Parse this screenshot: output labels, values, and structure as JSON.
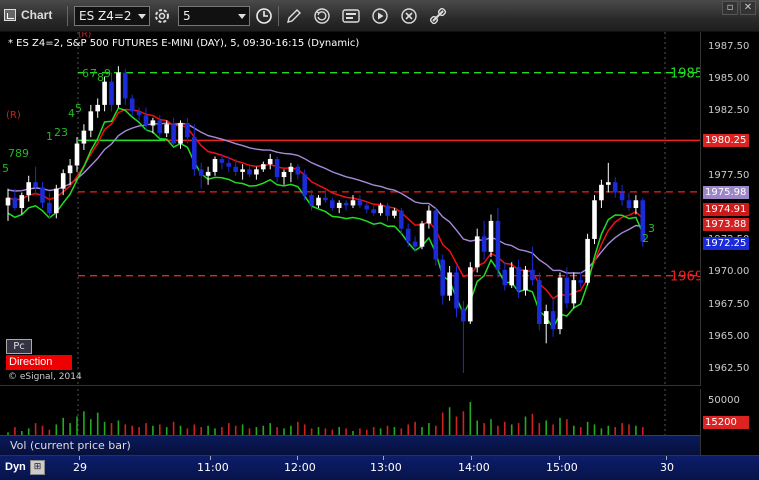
{
  "toolbar": {
    "title": "Chart",
    "symbol_value": "ES Z4=2",
    "interval_value": "5",
    "icons": [
      "chart-window-icon",
      "settings-cog-icon",
      "clock-icon",
      "pencil-icon",
      "refresh-icon",
      "news-icon",
      "play-icon",
      "close-circle-icon",
      "link-icon"
    ],
    "window_buttons": [
      "restore",
      "close"
    ]
  },
  "header": {
    "text": "* ES Z4=2, S&P 500 FUTURES E-MINI (DAY), 5, 09:30-16:15 (Dynamic)"
  },
  "overlay": {
    "pc_label": "Pc",
    "direction_label": "Direction",
    "copyright": "© eSignal, 2014",
    "r_label": "(R)",
    "r_label_top": "(R)",
    "green_labels": [
      "5",
      "789",
      "1",
      "2",
      "3",
      "4",
      "5",
      "6",
      "7",
      "8",
      "9",
      "2",
      "3"
    ]
  },
  "price_axis": {
    "labels": [
      "1987.50",
      "1985.00",
      "1982.50",
      "1980.00",
      "1977.50",
      "1975.00",
      "1972.50",
      "1970.00",
      "1967.50",
      "1965.00",
      "1962.50"
    ],
    "tags": [
      {
        "text": "1980.25",
        "color": "#dd2222",
        "text_color": "#ffffff"
      },
      {
        "text": "1975.98",
        "color": "#9b87c8",
        "text_color": "#ffffff"
      },
      {
        "text": "1974.91",
        "color": "#cc1a1a",
        "text_color": "#ffffff"
      },
      {
        "text": "1973.88",
        "color": "#d42020",
        "text_color": "#ffffff"
      },
      {
        "text": "1972.25",
        "color": "#1b2bd8",
        "text_color": "#ffffff"
      }
    ],
    "level_labels": [
      {
        "text": "1985",
        "color": "#22dd22"
      },
      {
        "text": "1969",
        "color": "#ee2222"
      }
    ]
  },
  "volume": {
    "label": "Vol (current price bar)",
    "axis_labels": [
      "50000"
    ],
    "tag": {
      "text": "15200",
      "color": "#dd2222"
    }
  },
  "time_axis": {
    "dyn_label": "Dyn",
    "dyn_button": "⊞",
    "labels": [
      "29",
      "11:00",
      "12:00",
      "13:00",
      "14:00",
      "15:00",
      "30"
    ]
  },
  "colors": {
    "up_bar": "#ffffff",
    "down_bar": "#1b2bd8",
    "ema_red": "#ee1111",
    "ma_purple": "#a58ad6",
    "green_line": "#22dd22",
    "level_red": "#ee2222",
    "level_green": "#22dd22"
  },
  "chart_data": {
    "type": "candlestick",
    "title": "* ES Z4=2, S&P 500 FUTURES E-MINI (DAY), 5, 09:30-16:15 (Dynamic)",
    "y_range": [
      1961.5,
      1988.5
    ],
    "levels": [
      {
        "value": 1985.5,
        "label": "1985",
        "color": "green",
        "style": "dashed"
      },
      {
        "value": 1980.25,
        "label": "",
        "color": "red",
        "style": "solid"
      },
      {
        "value": 1976.25,
        "label": "",
        "color": "red",
        "style": "dashed"
      },
      {
        "value": 1969.75,
        "label": "1969",
        "color": "red",
        "style": "dashed"
      },
      {
        "value": 1980.25,
        "label": "",
        "color": "green",
        "style": "solid-short"
      }
    ],
    "candles": [
      {
        "o": 1975.2,
        "h": 1976.5,
        "l": 1974.0,
        "c": 1975.8
      },
      {
        "o": 1975.8,
        "h": 1976.5,
        "l": 1974.8,
        "c": 1975.0
      },
      {
        "o": 1975.0,
        "h": 1976.2,
        "l": 1974.5,
        "c": 1976.0
      },
      {
        "o": 1976.0,
        "h": 1977.5,
        "l": 1975.5,
        "c": 1977.0
      },
      {
        "o": 1977.0,
        "h": 1978.2,
        "l": 1976.0,
        "c": 1976.6
      },
      {
        "o": 1976.6,
        "h": 1977.0,
        "l": 1975.0,
        "c": 1975.4
      },
      {
        "o": 1975.4,
        "h": 1976.2,
        "l": 1974.2,
        "c": 1974.6
      },
      {
        "o": 1974.6,
        "h": 1976.8,
        "l": 1974.2,
        "c": 1976.5
      },
      {
        "o": 1976.5,
        "h": 1978.0,
        "l": 1976.0,
        "c": 1977.7
      },
      {
        "o": 1977.7,
        "h": 1978.8,
        "l": 1976.8,
        "c": 1978.3
      },
      {
        "o": 1978.3,
        "h": 1980.5,
        "l": 1977.8,
        "c": 1980.0
      },
      {
        "o": 1980.0,
        "h": 1981.5,
        "l": 1979.5,
        "c": 1981.0
      },
      {
        "o": 1981.0,
        "h": 1983.0,
        "l": 1980.5,
        "c": 1982.5
      },
      {
        "o": 1982.5,
        "h": 1983.5,
        "l": 1982.0,
        "c": 1983.0
      },
      {
        "o": 1983.0,
        "h": 1985.2,
        "l": 1982.5,
        "c": 1984.8
      },
      {
        "o": 1984.8,
        "h": 1985.5,
        "l": 1982.5,
        "c": 1983.0
      },
      {
        "o": 1983.0,
        "h": 1986.0,
        "l": 1982.8,
        "c": 1985.5
      },
      {
        "o": 1985.5,
        "h": 1985.8,
        "l": 1983.0,
        "c": 1983.5
      },
      {
        "o": 1983.5,
        "h": 1983.8,
        "l": 1982.2,
        "c": 1982.5
      },
      {
        "o": 1982.5,
        "h": 1982.8,
        "l": 1981.8,
        "c": 1982.2
      },
      {
        "o": 1982.2,
        "h": 1982.8,
        "l": 1981.0,
        "c": 1981.4
      },
      {
        "o": 1981.4,
        "h": 1982.0,
        "l": 1980.8,
        "c": 1981.8
      },
      {
        "o": 1981.8,
        "h": 1982.2,
        "l": 1980.4,
        "c": 1980.8
      },
      {
        "o": 1980.8,
        "h": 1981.8,
        "l": 1980.5,
        "c": 1981.5
      },
      {
        "o": 1981.5,
        "h": 1982.0,
        "l": 1979.8,
        "c": 1980.0
      },
      {
        "o": 1980.0,
        "h": 1981.8,
        "l": 1979.6,
        "c": 1981.6
      },
      {
        "o": 1981.6,
        "h": 1982.0,
        "l": 1980.0,
        "c": 1980.5
      },
      {
        "o": 1980.5,
        "h": 1981.5,
        "l": 1977.5,
        "c": 1978.0
      },
      {
        "o": 1978.0,
        "h": 1978.5,
        "l": 1976.5,
        "c": 1977.5
      },
      {
        "o": 1977.5,
        "h": 1978.2,
        "l": 1976.8,
        "c": 1977.8
      },
      {
        "o": 1977.8,
        "h": 1979.0,
        "l": 1977.5,
        "c": 1978.8
      },
      {
        "o": 1978.8,
        "h": 1979.2,
        "l": 1978.0,
        "c": 1978.5
      },
      {
        "o": 1978.5,
        "h": 1979.0,
        "l": 1977.8,
        "c": 1978.2
      },
      {
        "o": 1978.2,
        "h": 1978.8,
        "l": 1977.5,
        "c": 1977.8
      },
      {
        "o": 1977.8,
        "h": 1978.4,
        "l": 1977.2,
        "c": 1978.0
      },
      {
        "o": 1978.0,
        "h": 1978.4,
        "l": 1977.4,
        "c": 1977.6
      },
      {
        "o": 1977.6,
        "h": 1978.2,
        "l": 1977.2,
        "c": 1978.0
      },
      {
        "o": 1978.0,
        "h": 1978.6,
        "l": 1977.8,
        "c": 1978.4
      },
      {
        "o": 1978.4,
        "h": 1979.2,
        "l": 1978.0,
        "c": 1978.8
      },
      {
        "o": 1978.8,
        "h": 1979.0,
        "l": 1977.0,
        "c": 1977.4
      },
      {
        "o": 1977.4,
        "h": 1978.0,
        "l": 1976.8,
        "c": 1977.8
      },
      {
        "o": 1977.8,
        "h": 1978.5,
        "l": 1977.0,
        "c": 1978.2
      },
      {
        "o": 1978.2,
        "h": 1978.4,
        "l": 1977.2,
        "c": 1977.6
      },
      {
        "o": 1977.6,
        "h": 1978.0,
        "l": 1975.6,
        "c": 1976.0
      },
      {
        "o": 1976.0,
        "h": 1976.4,
        "l": 1974.8,
        "c": 1975.2
      },
      {
        "o": 1975.2,
        "h": 1976.0,
        "l": 1975.0,
        "c": 1975.8
      },
      {
        "o": 1975.8,
        "h": 1976.4,
        "l": 1975.4,
        "c": 1975.6
      },
      {
        "o": 1975.6,
        "h": 1975.8,
        "l": 1974.8,
        "c": 1975.0
      },
      {
        "o": 1975.0,
        "h": 1975.6,
        "l": 1974.6,
        "c": 1975.4
      },
      {
        "o": 1975.4,
        "h": 1975.6,
        "l": 1974.8,
        "c": 1975.2
      },
      {
        "o": 1975.2,
        "h": 1976.0,
        "l": 1975.0,
        "c": 1975.6
      },
      {
        "o": 1975.6,
        "h": 1976.0,
        "l": 1975.0,
        "c": 1975.2
      },
      {
        "o": 1975.2,
        "h": 1975.4,
        "l": 1974.6,
        "c": 1974.9
      },
      {
        "o": 1974.9,
        "h": 1975.2,
        "l": 1974.4,
        "c": 1974.6
      },
      {
        "o": 1974.6,
        "h": 1975.4,
        "l": 1974.4,
        "c": 1975.2
      },
      {
        "o": 1975.2,
        "h": 1975.4,
        "l": 1974.0,
        "c": 1974.4
      },
      {
        "o": 1974.4,
        "h": 1975.0,
        "l": 1974.2,
        "c": 1974.8
      },
      {
        "o": 1974.8,
        "h": 1975.0,
        "l": 1973.0,
        "c": 1973.4
      },
      {
        "o": 1973.4,
        "h": 1973.8,
        "l": 1972.0,
        "c": 1972.4
      },
      {
        "o": 1972.4,
        "h": 1972.8,
        "l": 1971.6,
        "c": 1972.0
      },
      {
        "o": 1972.0,
        "h": 1974.0,
        "l": 1971.8,
        "c": 1973.8
      },
      {
        "o": 1973.8,
        "h": 1975.2,
        "l": 1973.4,
        "c": 1974.8
      },
      {
        "o": 1974.8,
        "h": 1975.0,
        "l": 1970.5,
        "c": 1971.0
      },
      {
        "o": 1971.0,
        "h": 1971.4,
        "l": 1967.5,
        "c": 1968.2
      },
      {
        "o": 1968.2,
        "h": 1970.5,
        "l": 1967.8,
        "c": 1970.0
      },
      {
        "o": 1970.0,
        "h": 1970.5,
        "l": 1966.5,
        "c": 1967.2
      },
      {
        "o": 1967.2,
        "h": 1967.8,
        "l": 1962.2,
        "c": 1966.2
      },
      {
        "o": 1966.2,
        "h": 1970.8,
        "l": 1966.0,
        "c": 1970.4
      },
      {
        "o": 1970.4,
        "h": 1973.4,
        "l": 1970.0,
        "c": 1972.8
      },
      {
        "o": 1972.8,
        "h": 1974.0,
        "l": 1971.0,
        "c": 1971.6
      },
      {
        "o": 1971.6,
        "h": 1974.5,
        "l": 1971.2,
        "c": 1974.0
      },
      {
        "o": 1974.0,
        "h": 1975.0,
        "l": 1969.6,
        "c": 1970.2
      },
      {
        "o": 1970.2,
        "h": 1970.8,
        "l": 1968.6,
        "c": 1969.0
      },
      {
        "o": 1969.0,
        "h": 1970.8,
        "l": 1968.8,
        "c": 1970.4
      },
      {
        "o": 1970.4,
        "h": 1971.0,
        "l": 1968.0,
        "c": 1968.6
      },
      {
        "o": 1968.6,
        "h": 1970.5,
        "l": 1968.2,
        "c": 1970.2
      },
      {
        "o": 1970.2,
        "h": 1972.0,
        "l": 1969.0,
        "c": 1969.4
      },
      {
        "o": 1969.4,
        "h": 1970.0,
        "l": 1965.5,
        "c": 1966.0
      },
      {
        "o": 1966.0,
        "h": 1967.5,
        "l": 1964.5,
        "c": 1967.0
      },
      {
        "o": 1967.0,
        "h": 1968.0,
        "l": 1965.0,
        "c": 1965.6
      },
      {
        "o": 1965.6,
        "h": 1970.0,
        "l": 1965.2,
        "c": 1969.6
      },
      {
        "o": 1969.6,
        "h": 1970.4,
        "l": 1967.2,
        "c": 1967.6
      },
      {
        "o": 1967.6,
        "h": 1970.0,
        "l": 1967.2,
        "c": 1969.4
      },
      {
        "o": 1969.4,
        "h": 1970.0,
        "l": 1968.8,
        "c": 1969.2
      },
      {
        "o": 1969.2,
        "h": 1973.0,
        "l": 1969.0,
        "c": 1972.6
      },
      {
        "o": 1972.6,
        "h": 1976.0,
        "l": 1972.2,
        "c": 1975.6
      },
      {
        "o": 1975.6,
        "h": 1977.2,
        "l": 1975.0,
        "c": 1976.8
      },
      {
        "o": 1976.8,
        "h": 1978.5,
        "l": 1976.2,
        "c": 1977.0
      },
      {
        "o": 1977.0,
        "h": 1977.4,
        "l": 1975.8,
        "c": 1976.2
      },
      {
        "o": 1976.2,
        "h": 1976.8,
        "l": 1975.2,
        "c": 1975.6
      },
      {
        "o": 1975.6,
        "h": 1976.2,
        "l": 1974.8,
        "c": 1975.0
      },
      {
        "o": 1975.0,
        "h": 1976.0,
        "l": 1974.5,
        "c": 1975.6
      },
      {
        "o": 1975.6,
        "h": 1975.8,
        "l": 1972.0,
        "c": 1972.4
      }
    ],
    "volume": [
      2,
      6,
      3,
      5,
      9,
      7,
      4,
      8,
      13,
      9,
      14,
      18,
      12,
      17,
      10,
      9,
      11,
      8,
      7,
      6,
      9,
      7,
      8,
      6,
      10,
      7,
      5,
      8,
      6,
      7,
      5,
      6,
      9,
      7,
      8,
      5,
      6,
      7,
      9,
      6,
      5,
      7,
      10,
      8,
      5,
      6,
      5,
      4,
      6,
      5,
      3,
      5,
      4,
      6,
      5,
      7,
      6,
      5,
      8,
      10,
      6,
      9,
      7,
      17,
      21,
      14,
      18,
      25,
      11,
      9,
      12,
      7,
      10,
      8,
      9,
      14,
      16,
      9,
      11,
      8,
      13,
      12,
      7,
      6,
      10,
      8,
      5,
      7,
      6,
      9,
      8,
      7,
      6
    ],
    "volume_range": [
      0,
      60000
    ]
  }
}
